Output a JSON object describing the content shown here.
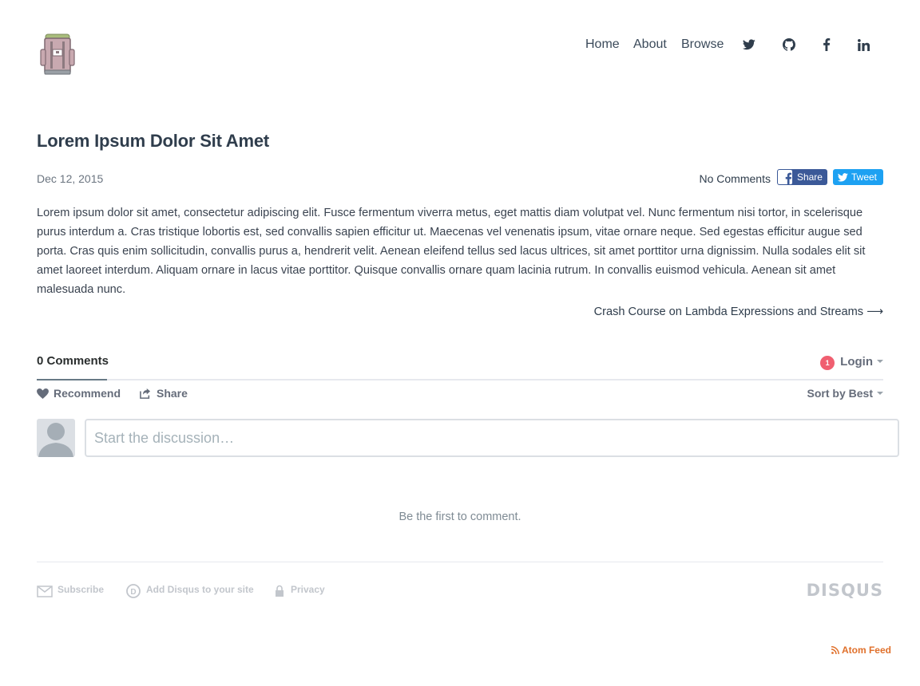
{
  "header": {
    "nav": [
      {
        "label": "Home"
      },
      {
        "label": "About"
      },
      {
        "label": "Browse"
      }
    ],
    "social": [
      "twitter-icon",
      "github-icon",
      "facebook-icon",
      "linkedin-icon"
    ]
  },
  "post": {
    "title": "Lorem Ipsum Dolor Sit Amet",
    "date": "Dec 12, 2015",
    "comments_link": "No Comments",
    "share_label": "Share",
    "tweet_label": "Tweet",
    "body": "Lorem ipsum dolor sit amet, consectetur adipiscing elit. Fusce fermentum viverra metus, eget mattis diam volutpat vel. Nunc fermentum nisi tortor, in scelerisque purus interdum a. Cras tristique lobortis est, sed convallis sapien efficitur ut. Maecenas vel venenatis ipsum, vitae ornare neque. Sed egestas efficitur augue sed porta. Cras quis enim sollicitudin, convallis purus a, hendrerit velit. Aenean eleifend tellus sed lacus ultrices, sit amet porttitor urna dignissim. Nulla sodales elit sit amet laoreet interdum. Aliquam ornare in lacus vitae porttitor. Quisque convallis ornare quam lacinia rutrum. In convallis euismod vehicula. Aenean sit amet malesuada nunc.",
    "next_post": "Crash Course on Lambda Expressions and Streams ⟶"
  },
  "disqus": {
    "comment_count": "0 Comments",
    "login_label": "Login",
    "notification_count": "1",
    "recommend_label": "Recommend",
    "share_label": "Share",
    "sort_label": "Sort by Best",
    "input_placeholder": "Start the discussion…",
    "empty_message": "Be the first to comment.",
    "footer": {
      "subscribe": "Subscribe",
      "add_disqus": "Add Disqus to your site",
      "privacy": "Privacy",
      "brand": "DISQUS"
    }
  },
  "footer": {
    "atom_feed": "Atom Feed"
  },
  "colors": {
    "facebook": "#3b5998",
    "twitter": "#1da1f2",
    "notification": "#f05f70",
    "atom": "#e0702b"
  }
}
